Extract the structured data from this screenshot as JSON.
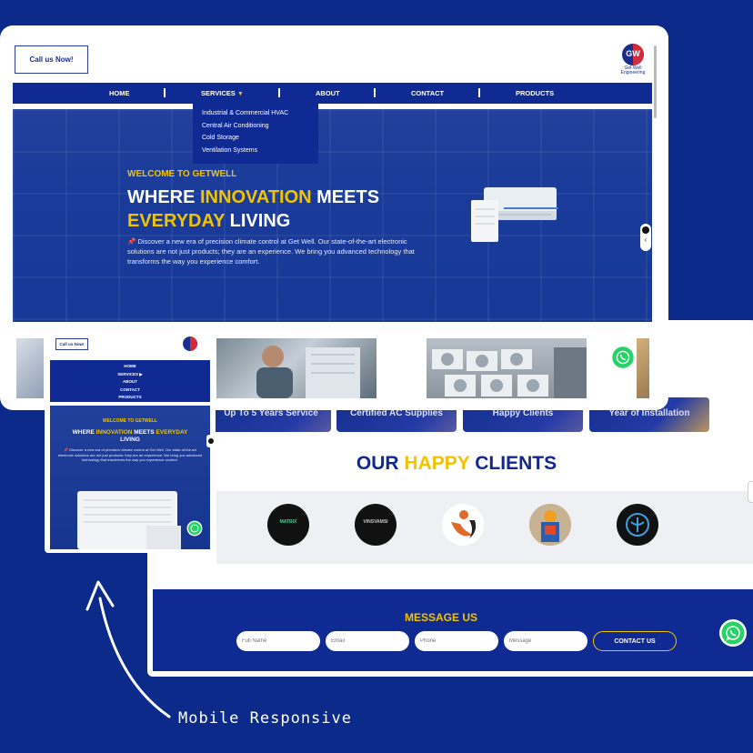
{
  "desktop": {
    "header": {
      "call_button": "Call us Now!",
      "brand_name": "Get Well Engineering",
      "brand_initials": "GW"
    },
    "nav": {
      "items": [
        "HOME",
        "SERVICES",
        "ABOUT",
        "CONTACT",
        "PRODUCTS"
      ]
    },
    "services_dropdown": [
      "Industrial & Commercial HVAC",
      "Central Air Conditioning",
      "Cold Storage",
      "Ventilation Systems"
    ],
    "hero": {
      "welcome": "WELCOME TO GETWELL",
      "headline_1a": "WHERE ",
      "headline_1b": "INNOVATION",
      "headline_1c": " MEETS",
      "headline_2a": "EVERYDAY",
      "headline_2b": " LIVING",
      "description": "📌 Discover a new era of precision climate control at Get Well. Our state-of-the-art electronic solutions are not just products; they are an experience. We bring you advanced technology that transforms the way you experience comfort."
    },
    "stats": [
      "Up To 5 Years Service",
      "Certified AC Supplies",
      "Happy Clients",
      "Year of Installation"
    ],
    "clients": {
      "title_a": "OUR ",
      "title_b": "HAPPY",
      "title_c": " CLIENTS",
      "logos": [
        "matrix-logo",
        "vinsvamsi-logo",
        "hands-logo",
        "statue-logo",
        "medical-logo"
      ],
      "logo_labels": [
        "MATRIX",
        "VINSVAMSI"
      ]
    },
    "message": {
      "title": "MESSAGE US",
      "fields": [
        "Full Name",
        "Email",
        "Phone",
        "Message"
      ],
      "button": "CONTACT US"
    }
  },
  "mobile": {
    "call_button": "Call us Now!",
    "menu": [
      "HOME",
      "SERVICES ▶",
      "ABOUT",
      "CONTACT",
      "PRODUCTS"
    ],
    "welcome": "WELCOME TO GETWELL",
    "headline_a": "WHERE ",
    "headline_b": "INNOVATION",
    "headline_c": " MEETS ",
    "headline_d": "EVERYDAY",
    "headline_e": "LIVING",
    "description": "📌 Discover a new era of precision climate control at Get Well. Our state-of-the-art electronic solutions are not just products; they are an experience. We bring you advanced technology that transforms the way you experience comfort."
  },
  "caption": "Mobile Responsive",
  "colors": {
    "background": "#0c2a8a",
    "nav_blue": "#0f2a93",
    "accent_yellow": "#f2c400",
    "whatsapp_green": "#25d366"
  }
}
